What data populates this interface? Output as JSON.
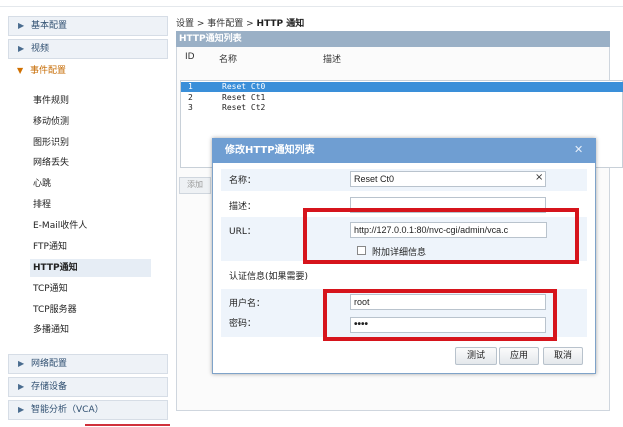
{
  "sidebar": {
    "items": [
      {
        "label": "基本配置",
        "expanded": false
      },
      {
        "label": "视频",
        "expanded": false
      },
      {
        "label": "事件配置",
        "expanded": true
      }
    ],
    "subitems": [
      "事件规则",
      "移动侦测",
      "图形识别",
      "网络丢失",
      "心跳",
      "排程",
      "E-Mail收件人",
      "FTP通知",
      "HTTP通知",
      "TCP通知",
      "TCP服务器",
      "多播通知"
    ],
    "selected_subitem": "HTTP通知",
    "bottom_items": [
      {
        "label": "网络配置"
      },
      {
        "label": "存储设备"
      },
      {
        "label": "智能分析（VCA）"
      }
    ]
  },
  "breadcrumb": {
    "path": "设置 > 事件配置 > ",
    "current": "HTTP 通知"
  },
  "list_panel": {
    "title": "HTTP通知列表",
    "columns": {
      "id": "ID",
      "name": "名称",
      "desc": "描述"
    },
    "rows": [
      {
        "id": "1",
        "name": "Reset Ct0",
        "selected": true
      },
      {
        "id": "2",
        "name": "Reset Ct1",
        "selected": false
      },
      {
        "id": "3",
        "name": "Reset Ct2",
        "selected": false
      }
    ],
    "add_button": "添加"
  },
  "dialog": {
    "title": "修改HTTP通知列表",
    "close_icon": "close-icon",
    "name_label": "名称：",
    "name_value": "Reset Ct0",
    "name_clear": "×",
    "desc_label": "描述：",
    "desc_value": "",
    "url_label": "URL：",
    "url_value": "http://127.0.0.1:80/nvc-cgi/admin/vca.c",
    "detail_checkbox_label": "附加详细信息",
    "detail_checked": false,
    "auth_label": "认证信息(如果需要)",
    "user_label": "用户名：",
    "user_value": "root",
    "password_label": "密码：",
    "password_value": "••••",
    "buttons": {
      "test": "测试",
      "apply": "应用",
      "cancel": "取消"
    }
  },
  "colors": {
    "accent": "#6f9ed2",
    "selection": "#3a8fd9",
    "annotation": "#d6141c",
    "active_menu": "#c66a00"
  }
}
